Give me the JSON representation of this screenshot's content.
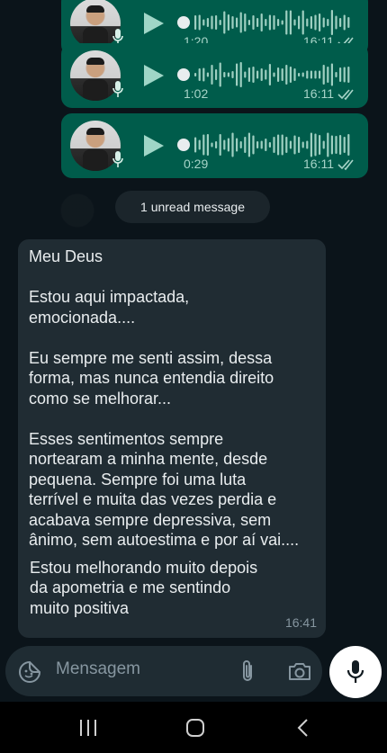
{
  "voice_messages": [
    {
      "duration": "1:20",
      "time": "16:11",
      "status": "read"
    },
    {
      "duration": "1:02",
      "time": "16:11",
      "status": "read"
    },
    {
      "duration": "0:29",
      "time": "16:11",
      "status": "read"
    }
  ],
  "unread_banner": "1 unread message",
  "incoming_message": {
    "paragraphs": [
      [
        "Meu Deus"
      ],
      [
        "Estou aqui impactada,",
        "emocionada...."
      ],
      [
        "Eu sempre me senti assim, dessa",
        "forma, mas nunca entendia direito",
        "como se melhorar..."
      ],
      [
        "Esses sentimentos sempre",
        "nortearam a minha mente, desde",
        "pequena. Sempre foi uma luta",
        "terrível e muita das vezes perdia e",
        "acabava sempre depressiva, sem",
        "ânimo, sem autoestima e por aí vai...."
      ]
    ],
    "last_paragraph": [
      "Estou melhorando muito depois",
      "da apometria e me sentindo",
      "muito positiva"
    ],
    "time": "16:41"
  },
  "composer": {
    "placeholder": "Mensagem",
    "emoji_icon": "sticker-emoji-icon",
    "attach_icon": "paperclip-icon",
    "camera_icon": "camera-icon",
    "mic_icon": "microphone-icon"
  },
  "nav": [
    "recent-apps-icon",
    "home-icon",
    "back-icon"
  ],
  "colors": {
    "outgoing_bubble": "#005c4b",
    "incoming_bubble": "#202c33",
    "background": "#0b141a",
    "tick_read": "#a7d4c8"
  }
}
